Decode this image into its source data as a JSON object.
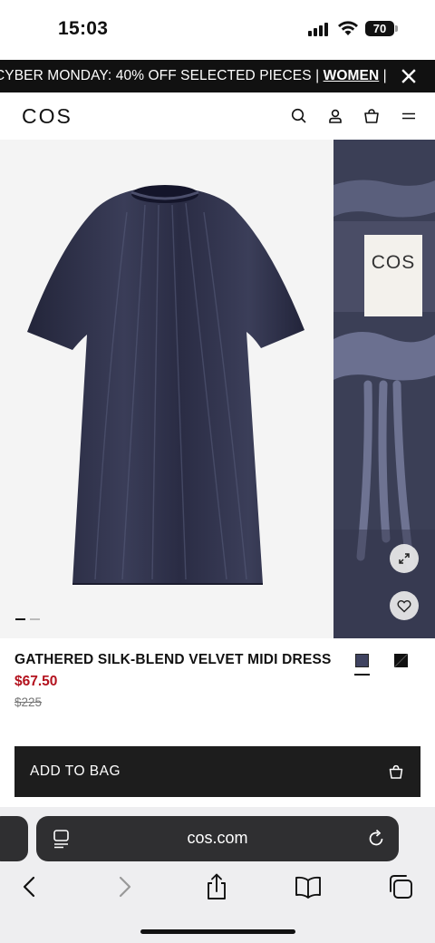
{
  "status": {
    "time": "15:03",
    "battery": "70"
  },
  "promo": {
    "text": "CYBER MONDAY: 40% OFF SELECTED PIECES | ",
    "link": "WOMEN",
    "trail": " |"
  },
  "header": {
    "logo": "COS"
  },
  "gallery": {
    "main_image": "navy-velvet-dress-photo",
    "next_image": "dress-neckline-detail-photo",
    "label_text": "COS",
    "dots_count": 2,
    "active_dot": 0
  },
  "product": {
    "name": "GATHERED SILK-BLEND VELVET MIDI DRESS",
    "sale_price": "$67.50",
    "original_price": "$225",
    "swatches": [
      {
        "name": "navy velvet",
        "color": "#3f4360",
        "selected": true
      },
      {
        "name": "black",
        "color": "#111111",
        "selected": false
      }
    ]
  },
  "add_to_bag": {
    "label": "ADD TO BAG"
  },
  "browser": {
    "url": "cos.com"
  },
  "colors": {
    "accent_sale": "#b3111d",
    "dress": "#2b2d45",
    "banner": "#111111"
  },
  "icons": [
    "search-icon",
    "account-icon",
    "bag-icon",
    "menu-icon",
    "close-icon",
    "expand-icon",
    "heart-icon",
    "reader-icon",
    "reload-icon",
    "back-icon",
    "forward-icon",
    "share-icon",
    "bookmarks-icon",
    "tabs-icon"
  ]
}
